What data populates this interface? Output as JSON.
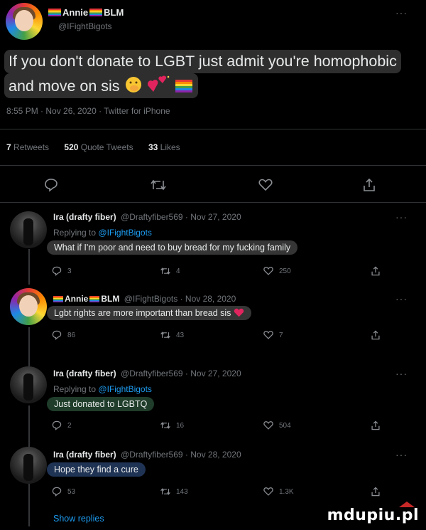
{
  "main_tweet": {
    "display_name": "Annie",
    "display_name_suffix": "BLM",
    "handle": "@IFightBigots",
    "text_line1": "If you don't donate to LGBT just admit you're homophobic",
    "text_line2": "and move on sis",
    "timestamp": "8:55 PM · Nov 26, 2020 · Twitter for iPhone",
    "stats": {
      "retweets_count": "7",
      "retweets_label": "Retweets",
      "quotes_count": "520",
      "quotes_label": "Quote Tweets",
      "likes_count": "33",
      "likes_label": "Likes"
    }
  },
  "replies": [
    {
      "name": "Ira (drafty fiber)",
      "meta": "@Draftyfiber569 · Nov 27, 2020",
      "replying_label": "Replying to",
      "replying_handle": "@IFightBigots",
      "text": "What if I'm poor and need to buy bread for my fucking family",
      "replies": "3",
      "retweets": "4",
      "likes": "250"
    },
    {
      "name_prefix": "Annie",
      "name_suffix": "BLM",
      "meta": "@IFightBigots · Nov 28, 2020",
      "text": "Lgbt rights are more important than bread sis",
      "replies": "86",
      "retweets": "43",
      "likes": "7"
    },
    {
      "name": "Ira (drafty fiber)",
      "meta": "@Draftyfiber569 · Nov 27, 2020",
      "replying_label": "Replying to",
      "replying_handle": "@IFightBigots",
      "text": "Just donated to LGBTQ",
      "replies": "2",
      "retweets": "16",
      "likes": "504"
    },
    {
      "name": "Ira (drafty fiber)",
      "meta": "@Draftyfiber569 · Nov 28, 2020",
      "text": "Hope they find a cure",
      "replies": "53",
      "retweets": "143",
      "likes": "1.3K"
    }
  ],
  "show_replies": "Show replies",
  "watermark": "mdupiu.pl",
  "more_label": "···",
  "colors": {
    "background": "#000000",
    "muted": "#71767b",
    "link": "#1d9bf0",
    "heart": "#e0245e"
  }
}
